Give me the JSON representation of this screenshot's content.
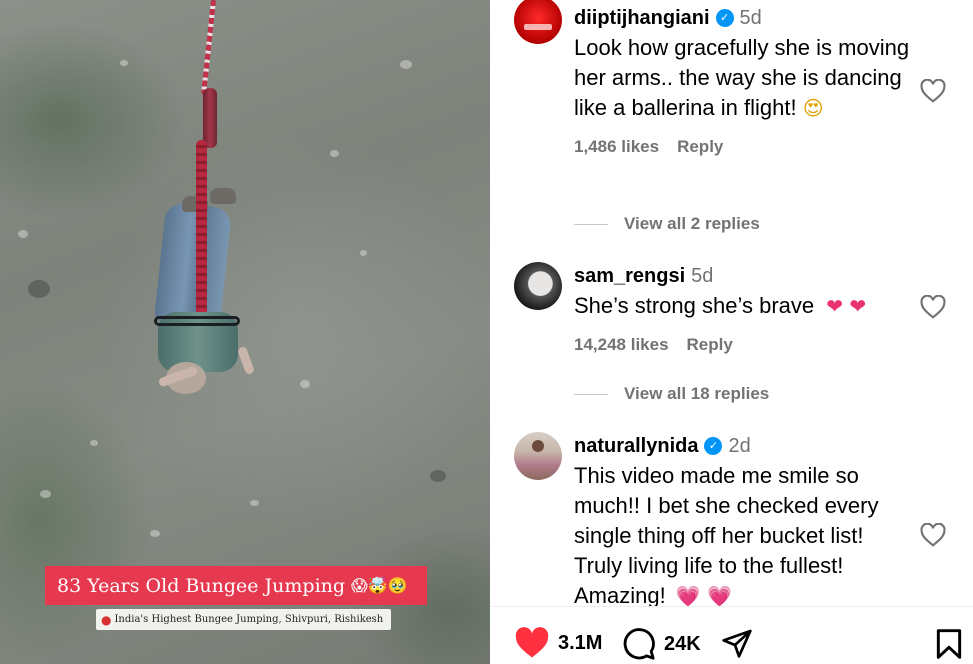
{
  "video": {
    "caption": "83 Years Old Bungee Jumping",
    "caption_emojis": "😱🤯🥹",
    "location": "India's Highest Bungee Jumping, Shivpuri, Rishikesh"
  },
  "comments": [
    {
      "username": "diiptijhangiani",
      "verified": true,
      "age": "5d",
      "text": "Look how gracefully she is moving her arms.. the way she is dancing like a ballerina in flight!",
      "emoji": "😍",
      "likes": "1,486 likes",
      "reply": "Reply",
      "view_replies": "View all 2 replies"
    },
    {
      "username": "sam_rengsi",
      "verified": false,
      "age": "5d",
      "text": "She’s strong she’s brave",
      "emoji": "❤ ❤",
      "likes": "14,248 likes",
      "reply": "Reply",
      "view_replies": "View all 18 replies"
    },
    {
      "username": "naturallynida",
      "verified": true,
      "age": "2d",
      "text": "This video made me smile so much!! I bet she checked every single thing off her bucket list! Truly living life to the fullest! Amazing!",
      "emoji": "💗 💗"
    }
  ],
  "actions": {
    "like_count": "3.1M",
    "comment_count": "24K"
  },
  "colors": {
    "like_red": "#ff3040",
    "caption_bg": "#e6394f",
    "verified_blue": "#0095f6",
    "secondary_text": "#737373"
  },
  "icons": [
    "heart-outline-icon",
    "verified-badge-icon",
    "heart-filled-icon",
    "comment-icon",
    "share-icon",
    "bookmark-icon",
    "location-pin-icon"
  ]
}
